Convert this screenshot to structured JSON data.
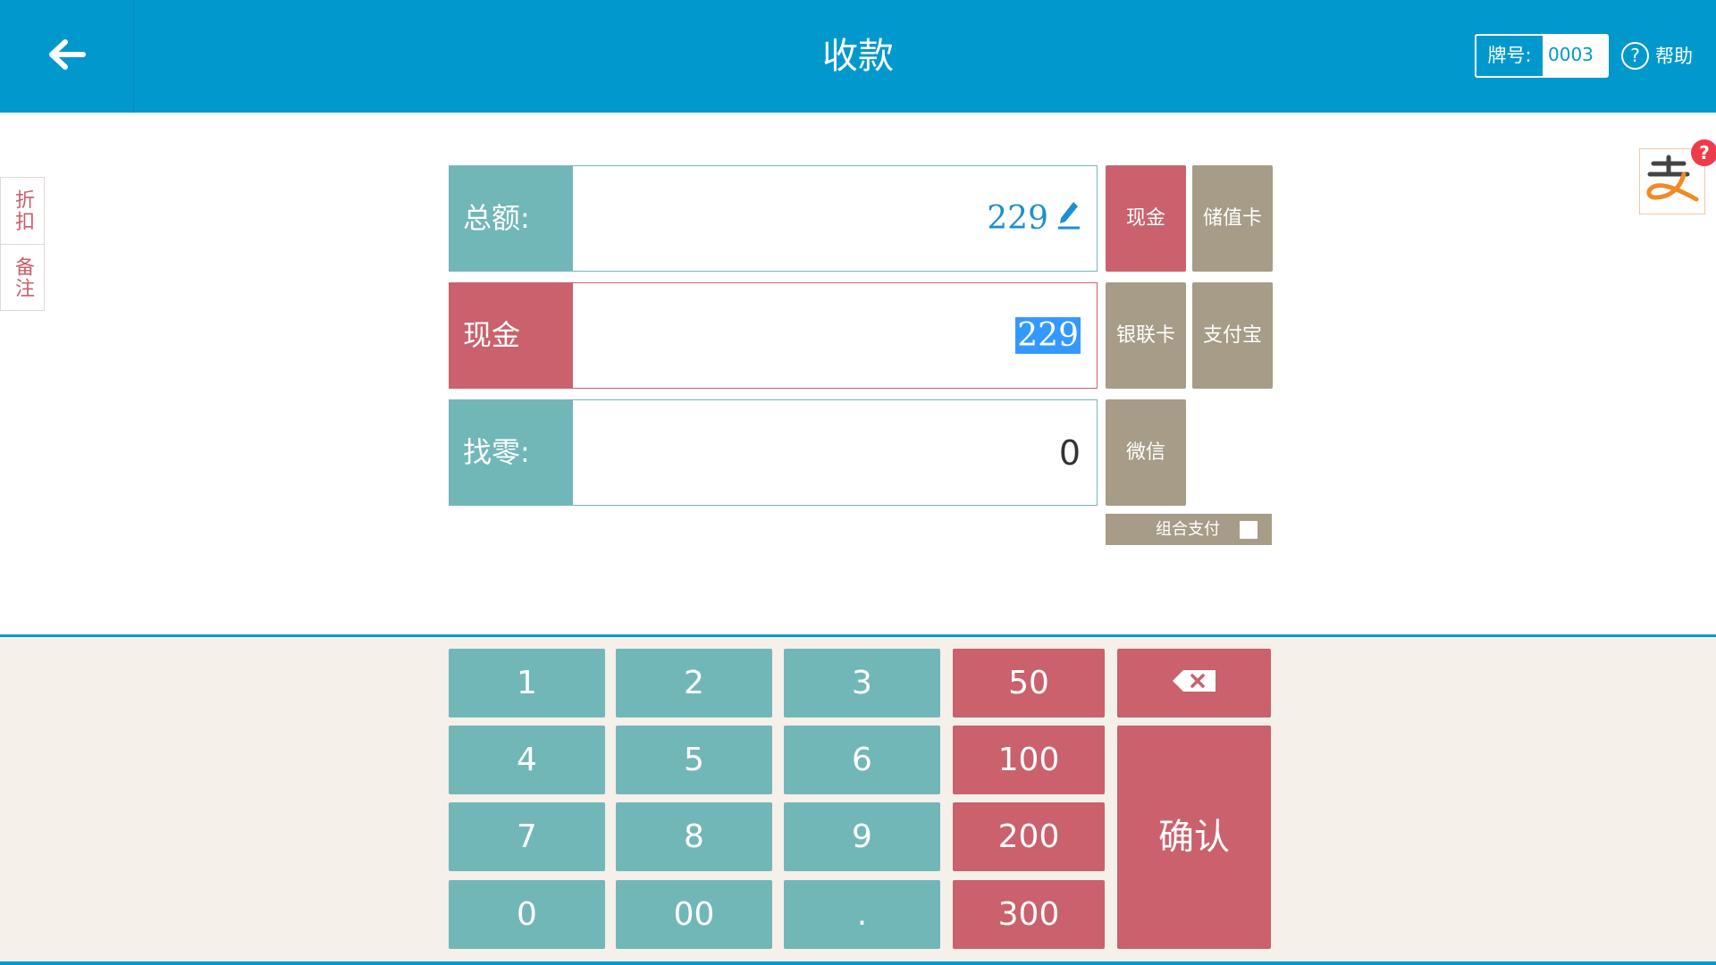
{
  "header": {
    "title": "收款",
    "tag_label": "牌号:",
    "tag_value": "0003",
    "help_label": "帮助"
  },
  "side_tabs": [
    "折扣",
    "备注"
  ],
  "payment": {
    "total_label": "总额:",
    "total_value": "229",
    "cash_label": "现金",
    "cash_value": "229",
    "change_label": "找零:",
    "change_value": "0"
  },
  "methods": {
    "cash": "现金",
    "stored_card": "储值卡",
    "unionpay": "银联卡",
    "alipay": "支付宝",
    "wechat": "微信",
    "combo_label": "组合支付"
  },
  "keypad": {
    "digits": [
      "1",
      "2",
      "3",
      "4",
      "5",
      "6",
      "7",
      "8",
      "9",
      "0",
      "00",
      "."
    ],
    "amounts": [
      "50",
      "100",
      "200",
      "300"
    ],
    "confirm": "确认"
  },
  "colors": {
    "header_blue": "#0199cd",
    "teal": "#72b7b8",
    "red": "#ca616c",
    "khaki": "#a69c87"
  }
}
